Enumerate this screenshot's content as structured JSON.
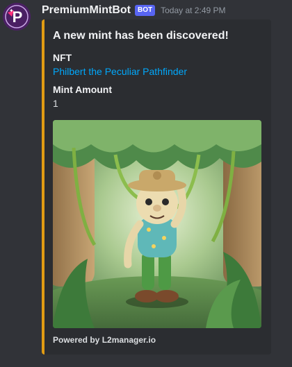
{
  "message": {
    "username": "PremiumMintBot",
    "bot_tag": "BOT",
    "timestamp": "Today at 2:49 PM",
    "avatar_letter": "P"
  },
  "embed": {
    "accent_color": "#e09b13",
    "title": "A new mint has been discovered!",
    "fields": [
      {
        "name": "NFT",
        "value": "Philbert the Peculiar Pathfinder",
        "is_link": true
      },
      {
        "name": "Mint Amount",
        "value": "1",
        "is_link": false
      }
    ],
    "image_icon": "nft-character-image",
    "footer": "Powered by L2manager.io"
  },
  "colors": {
    "background": "#313338",
    "embed_background": "#2b2d31",
    "link": "#00a8fc",
    "bot_tag": "#5865f2"
  }
}
